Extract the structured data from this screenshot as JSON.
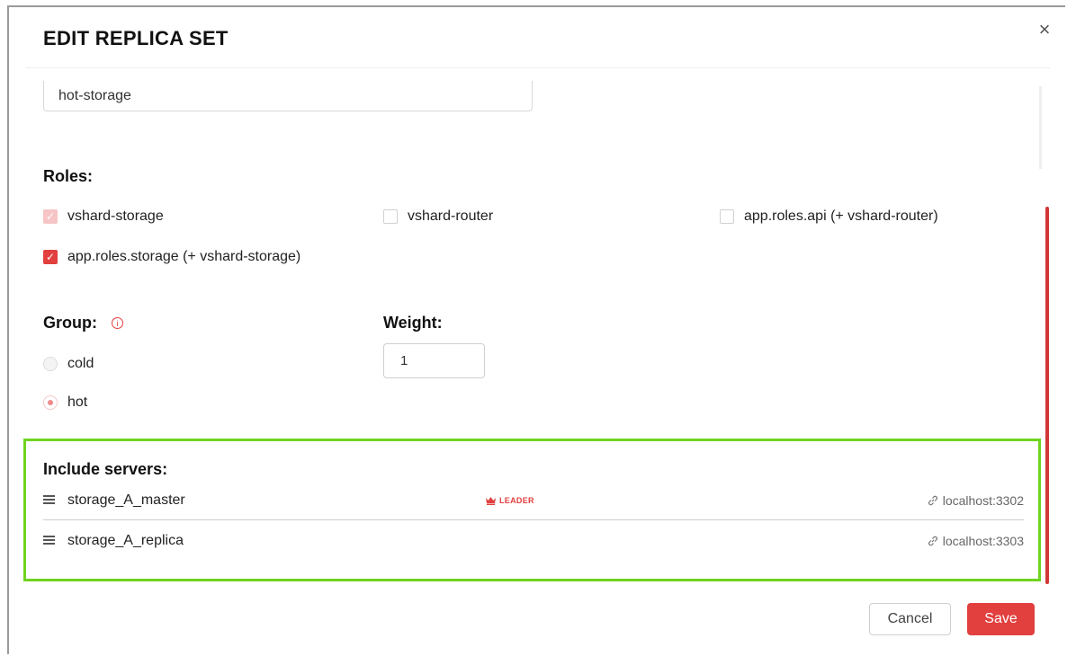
{
  "dialog": {
    "title": "EDIT REPLICA SET",
    "close_label": "×",
    "name_value": "hot-storage"
  },
  "roles": {
    "label": "Roles:",
    "items": [
      {
        "label": "vshard-storage",
        "state": "checked-disabled"
      },
      {
        "label": "vshard-router",
        "state": "unchecked"
      },
      {
        "label": "app.roles.api (+ vshard-router)",
        "state": "unchecked"
      },
      {
        "label": "app.roles.storage (+ vshard-storage)",
        "state": "checked"
      }
    ],
    "check_glyph": "✓"
  },
  "group": {
    "label": "Group:",
    "info_glyph": "i",
    "options": [
      {
        "label": "cold",
        "selected": false
      },
      {
        "label": "hot",
        "selected": true
      }
    ]
  },
  "weight": {
    "label": "Weight:",
    "value": "1"
  },
  "servers": {
    "label": "Include servers:",
    "rows": [
      {
        "name": "storage_A_master",
        "badge": "LEADER",
        "badge_icon": "crown-icon",
        "address": "localhost:3302",
        "address_icon": "link-icon"
      },
      {
        "name": "storage_A_replica",
        "badge": "",
        "address": "localhost:3303",
        "address_icon": "link-icon"
      }
    ]
  },
  "footer": {
    "cancel_label": "Cancel",
    "save_label": "Save"
  },
  "colors": {
    "accent": "#e23f3f",
    "highlight_border": "#6fd31f"
  }
}
